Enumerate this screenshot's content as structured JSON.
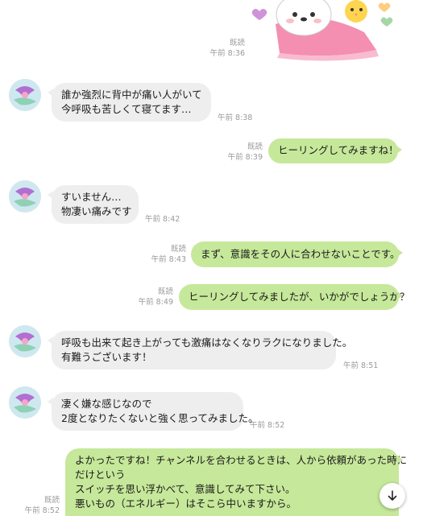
{
  "sticker": {
    "icon": "cat-and-chick-sticker-icon",
    "read": "既読",
    "time": "午前 8:36"
  },
  "messages": [
    {
      "id": "m1",
      "side": "in",
      "lines": [
        "誰か強烈に背中が痛い人がいて",
        "今呼吸も苦しくて寝てます…"
      ],
      "time": "午前 8:38"
    },
    {
      "id": "m2",
      "side": "out",
      "lines": [
        "ヒーリングしてみますね！"
      ],
      "read": "既読",
      "time": "午前 8:39"
    },
    {
      "id": "m3",
      "side": "in",
      "lines": [
        "すいません…",
        "物凄い痛みです"
      ],
      "time": "午前 8:42"
    },
    {
      "id": "m4",
      "side": "out",
      "lines": [
        "まず、意識をその人に合わせないことです。"
      ],
      "read": "既読",
      "time": "午前 8:43"
    },
    {
      "id": "m5",
      "side": "out",
      "lines": [
        "ヒーリングしてみましたが、いかがでしょうか？"
      ],
      "read": "既読",
      "time": "午前 8:49"
    },
    {
      "id": "m6",
      "side": "in",
      "lines": [
        "呼吸も出来て起き上がっても激痛はなくなりラクになりました。",
        "有難うございます！"
      ],
      "time": "午前 8:51"
    },
    {
      "id": "m7",
      "side": "in",
      "lines": [
        "凄く嫌な感じなので",
        "2度となりたくないと強く思ってみました。"
      ],
      "time": "午前 8:52"
    },
    {
      "id": "m8",
      "side": "out",
      "lines": [
        "よかったですね！チャンネルを合わせるときは、人から依頼があった時に",
        "だけという",
        "スイッチを思い浮かべて、意識してみて下さい。",
        "悪いもの（エネルギー）はそこら中いますから。"
      ],
      "read": "既読",
      "time": "午前 8:52"
    }
  ],
  "scroll_button": {
    "icon": "arrow-down-icon"
  }
}
